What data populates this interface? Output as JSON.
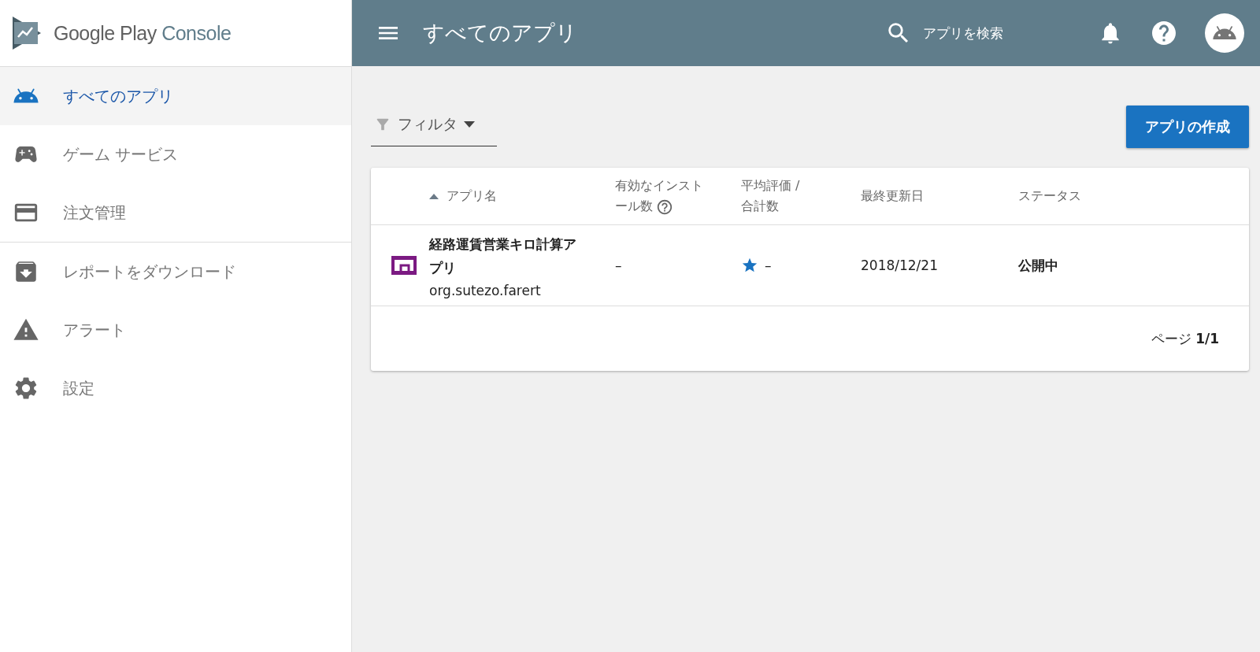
{
  "brand": {
    "primary": "Google Play",
    "secondary": "Console"
  },
  "sidebar": {
    "groups": [
      [
        {
          "label": "すべてのアプリ",
          "selected": true
        },
        {
          "label": "ゲーム サービス",
          "selected": false
        },
        {
          "label": "注文管理",
          "selected": false
        }
      ],
      [
        {
          "label": "レポートをダウンロード",
          "selected": false
        },
        {
          "label": "アラート",
          "selected": false
        },
        {
          "label": "設定",
          "selected": false
        }
      ]
    ]
  },
  "header": {
    "title": "すべてのアプリ",
    "search": {
      "placeholder": "アプリを検索"
    }
  },
  "filter": {
    "label": "フィルタ"
  },
  "create_button": "アプリの作成",
  "table": {
    "columns": [
      {
        "label": "アプリ名",
        "sorted": true,
        "help": false
      },
      {
        "label": "有効なインストール数",
        "sorted": false,
        "help": true
      },
      {
        "label": "平均評価 / 合計数",
        "sorted": false,
        "help": false
      },
      {
        "label": "最終更新日",
        "sorted": false,
        "help": false
      },
      {
        "label": "ステータス",
        "sorted": false,
        "help": false
      }
    ],
    "rows": [
      {
        "name": "経路運賃営業キロ計算アプリ",
        "package": "org.sutezo.farert",
        "installs": "–",
        "rating": "–",
        "updated": "2018/12/21",
        "status": "公開中"
      }
    ],
    "pagination": "ページ **1/1**"
  }
}
